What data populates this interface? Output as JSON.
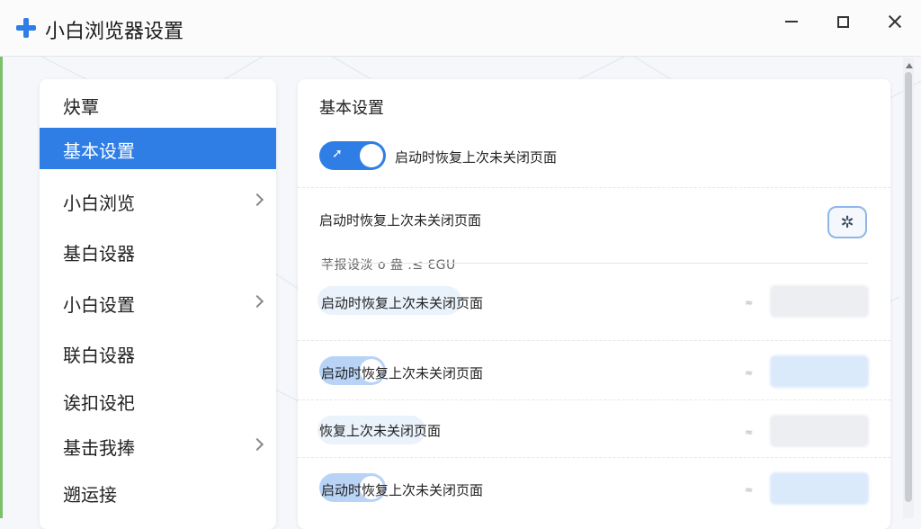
{
  "window": {
    "title": "小白浏览器设置",
    "icon": "plus-icon",
    "controls": [
      "minimize-icon",
      "maximize-icon",
      "close-icon"
    ],
    "accent_color": "#2f7ee6"
  },
  "sidebar": {
    "items": [
      {
        "label": "炔覃",
        "active": false,
        "chevron": false
      },
      {
        "label": "基本设置",
        "active": true,
        "chevron": false
      },
      {
        "label": "小白浏览",
        "active": false,
        "chevron": true
      },
      {
        "label": "基白设器",
        "active": false,
        "chevron": false
      },
      {
        "label": "小白设置",
        "active": false,
        "chevron": true
      },
      {
        "label": "联白设器",
        "active": false,
        "chevron": false
      },
      {
        "label": "诶扣设祀",
        "active": false,
        "chevron": false
      },
      {
        "label": "基击我捧",
        "active": false,
        "chevron": true
      },
      {
        "label": "遡运接",
        "active": false,
        "chevron": false
      }
    ]
  },
  "content": {
    "title": "基本设置",
    "row1": {
      "label": "启动时恢复上次未关闭页面",
      "toggle_on": true
    },
    "row2": {
      "label": "启动时恢复上次未关闭页面",
      "button_icon": "settings-icon"
    },
    "subsection": "芊报设淡 ο 盎 .≤ ƐGU",
    "row3": {
      "label": "启动时恢复上次未关闭页面",
      "mark": "≈"
    },
    "row4": {
      "label": "启动时恢复上次未关闭页面",
      "mark": "≈"
    },
    "row5": {
      "label": "恢复上次未关闭页面",
      "mark": "≈"
    },
    "row6": {
      "label": "启动时恢复上次未关闭页面",
      "mark": "≈"
    }
  }
}
